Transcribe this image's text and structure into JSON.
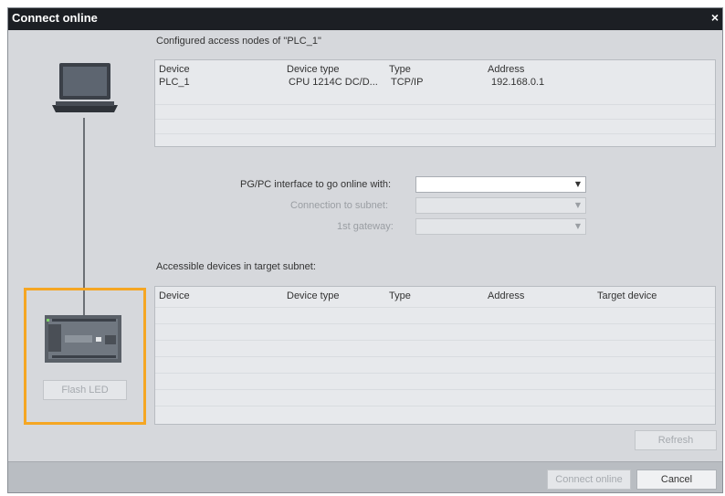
{
  "window": {
    "title": "Connect online",
    "close_icon": "×"
  },
  "configured": {
    "heading": "Configured access nodes of \"PLC_1\"",
    "columns": [
      "Device",
      "Device type",
      "Type",
      "Address"
    ],
    "rows": [
      [
        "PLC_1",
        "CPU 1214C DC/D...",
        "TCP/IP",
        "192.168.0.1"
      ]
    ]
  },
  "interface": {
    "pgpc_label": "PG/PC interface to go online with:",
    "pgpc_value": "",
    "subnet_label": "Connection to subnet:",
    "subnet_value": "",
    "gateway_label": "1st gateway:",
    "gateway_value": ""
  },
  "accessible": {
    "heading": "Accessible devices in target subnet:",
    "columns": [
      "Device",
      "Device type",
      "Type",
      "Address",
      "Target device"
    ]
  },
  "buttons": {
    "flash_led": "Flash LED",
    "refresh": "Refresh",
    "connect_online": "Connect online",
    "cancel": "Cancel"
  },
  "icons": {
    "laptop": "laptop-icon",
    "plc": "plc-device-icon",
    "dropdown": "chevron-down-icon",
    "close": "close-icon"
  }
}
